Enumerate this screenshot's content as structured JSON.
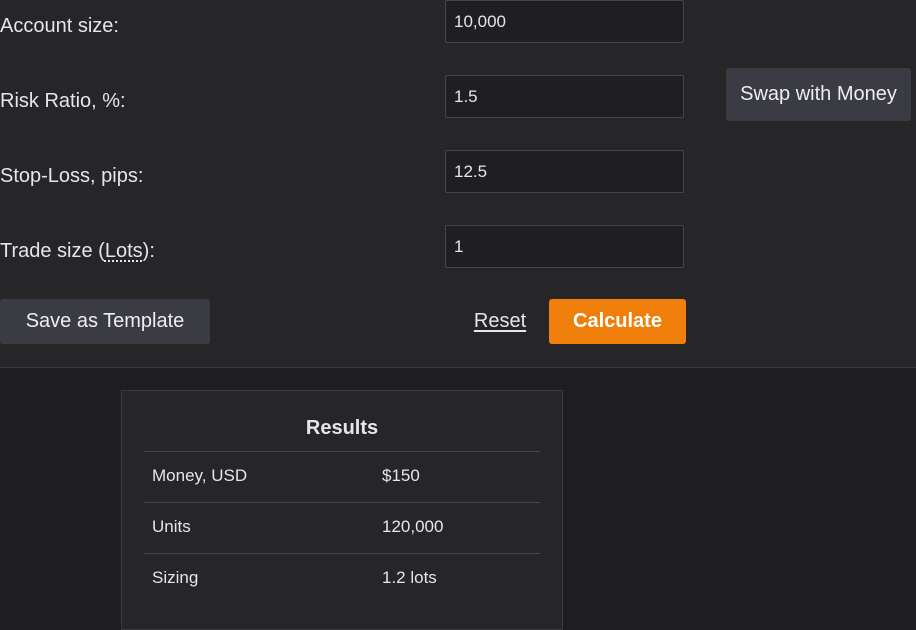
{
  "form": {
    "account_size": {
      "label": "Account size:",
      "value": "10,000"
    },
    "risk_ratio": {
      "label": "Risk Ratio, %:",
      "value": "1.5"
    },
    "stop_loss": {
      "label": "Stop-Loss, pips:",
      "value": "12.5"
    },
    "trade_size": {
      "label_prefix": "Trade size (",
      "label_abbr": "Lots",
      "label_suffix": "):",
      "value": "1"
    }
  },
  "buttons": {
    "swap": "Swap with Money",
    "save_template": "Save as Template",
    "reset": "Reset",
    "calculate": "Calculate"
  },
  "results": {
    "title": "Results",
    "rows": [
      {
        "key": "Money, USD",
        "value": "$150"
      },
      {
        "key": "Units",
        "value": "120,000"
      },
      {
        "key": "Sizing",
        "value": "1.2 lots"
      }
    ]
  },
  "colors": {
    "accent": "#ef7f0a",
    "panel": "#262629",
    "background": "#1d1d22"
  }
}
